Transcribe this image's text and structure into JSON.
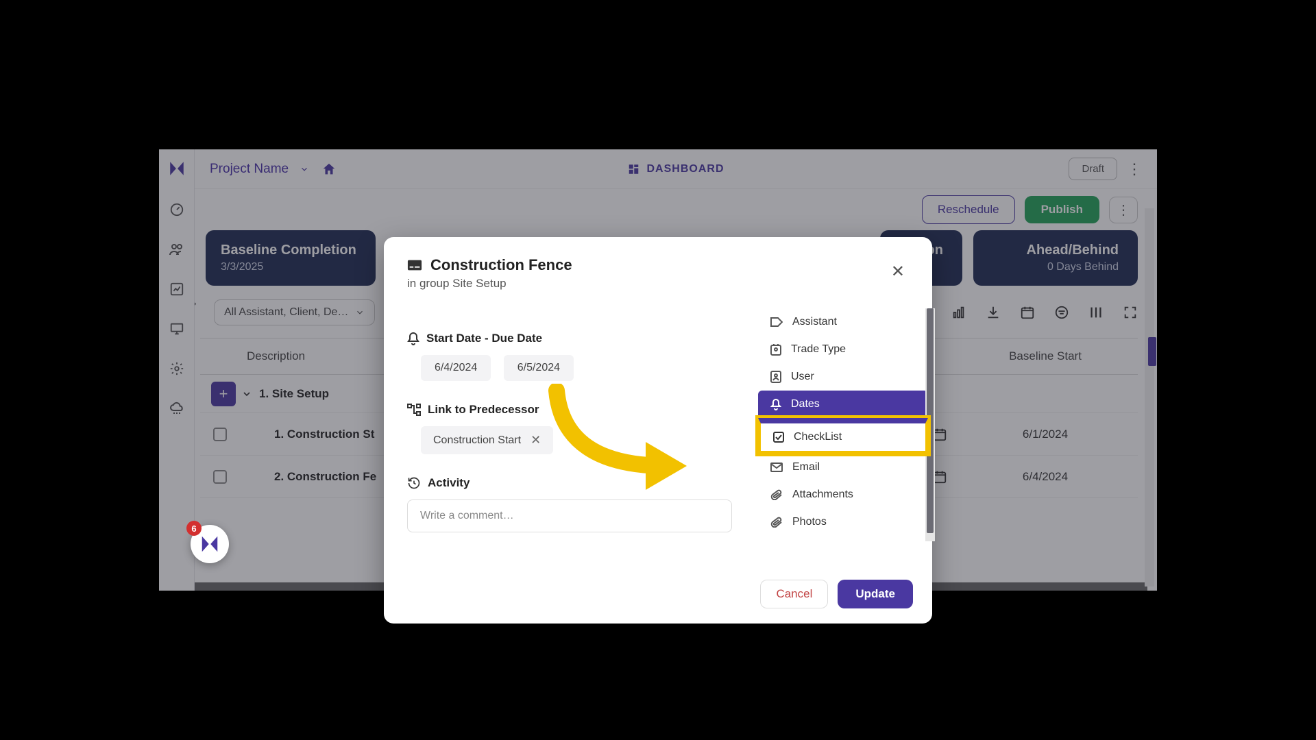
{
  "topbar": {
    "project_label": "Project Name",
    "dashboard_label": "DASHBOARD",
    "draft_label": "Draft"
  },
  "subbar": {
    "reschedule": "Reschedule",
    "publish": "Publish"
  },
  "metrics": {
    "baseline_title": "Baseline Completion",
    "baseline_value": "3/3/2025",
    "right1_title": "etion",
    "ahead_title": "Ahead/Behind",
    "ahead_value": "0 Days Behind"
  },
  "filters": {
    "assistant_filter": "All Assistant, Client, De…"
  },
  "table": {
    "col_description": "Description",
    "col_baseline_start": "Baseline Start",
    "group1": "1. Site Setup",
    "task1": "1. Construction St",
    "task1_date": "6/1/2024",
    "task2": "2. Construction Fe",
    "task2_date": "6/4/2024"
  },
  "modal": {
    "title": "Construction Fence",
    "subtitle": "in group Site Setup",
    "dates_label": "Start Date - Due Date",
    "start_date": "6/4/2024",
    "due_date": "6/5/2024",
    "predecessor_label": "Link to Predecessor",
    "predecessor_value": "Construction Start",
    "activity_label": "Activity",
    "comment_placeholder": "Write a comment…",
    "side": {
      "assistant": "Assistant",
      "trade_type": "Trade Type",
      "user": "User",
      "dates": "Dates",
      "checklist": "CheckList",
      "email": "Email",
      "attachments": "Attachments",
      "photos": "Photos"
    },
    "cancel": "Cancel",
    "update": "Update"
  },
  "assistant_badge": "6"
}
